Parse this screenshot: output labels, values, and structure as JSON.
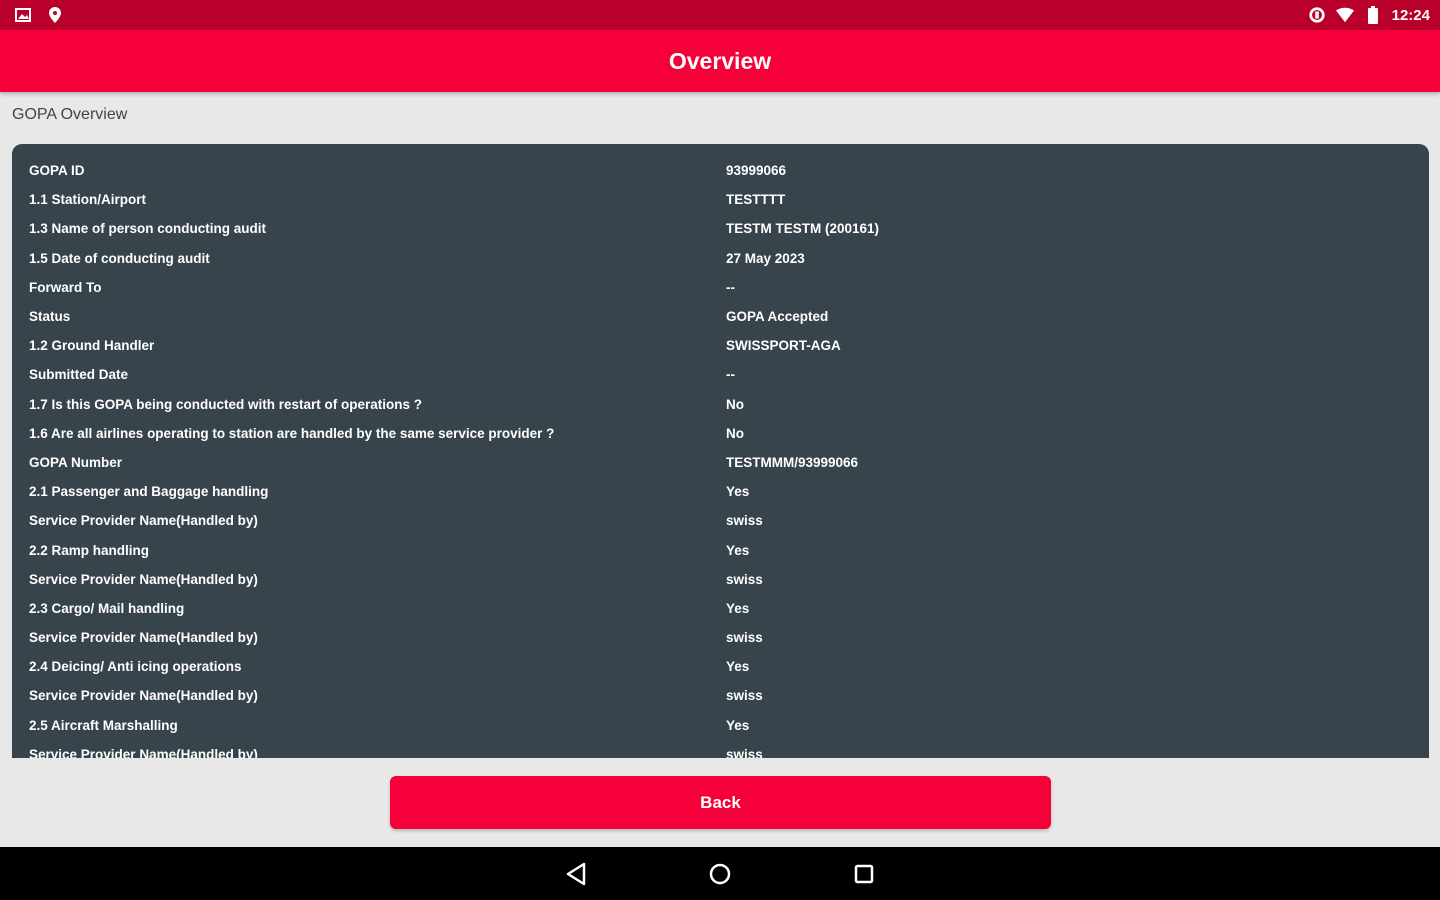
{
  "status_bar": {
    "time": "12:24",
    "left_icons": [
      "image-notification-icon",
      "location-pin-icon"
    ],
    "right_icons": [
      "data-saver-icon",
      "wifi-icon",
      "battery-icon"
    ]
  },
  "app_bar": {
    "title": "Overview"
  },
  "section": {
    "title": "GOPA Overview"
  },
  "details": [
    {
      "label": "GOPA ID",
      "value": "93999066"
    },
    {
      "label": "1.1 Station/Airport",
      "value": "TESTTTT"
    },
    {
      "label": "1.3 Name of person conducting audit",
      "value": "TESTM TESTM (200161)"
    },
    {
      "label": "1.5 Date of conducting audit",
      "value": "27 May 2023"
    },
    {
      "label": "Forward To",
      "value": "--"
    },
    {
      "label": "Status",
      "value": "GOPA Accepted"
    },
    {
      "label": "1.2 Ground Handler",
      "value": "SWISSPORT-AGA"
    },
    {
      "label": "Submitted Date",
      "value": "--"
    },
    {
      "label": "1.7 Is this GOPA being conducted with restart of operations ?",
      "value": "No"
    },
    {
      "label": "1.6 Are all airlines operating to station are handled by the same service provider ?",
      "value": "No"
    },
    {
      "label": "GOPA Number",
      "value": "TESTMMM/93999066"
    },
    {
      "label": "2.1 Passenger and Baggage handling",
      "value": "Yes"
    },
    {
      "label": "Service Provider Name(Handled by)",
      "value": "swiss"
    },
    {
      "label": "2.2 Ramp handling",
      "value": "Yes"
    },
    {
      "label": "Service Provider Name(Handled by)",
      "value": "swiss"
    },
    {
      "label": "2.3 Cargo/ Mail handling",
      "value": "Yes"
    },
    {
      "label": "Service Provider Name(Handled by)",
      "value": "swiss"
    },
    {
      "label": "2.4 Deicing/ Anti icing operations",
      "value": "Yes"
    },
    {
      "label": "Service Provider Name(Handled by)",
      "value": "swiss"
    },
    {
      "label": "2.5 Aircraft Marshalling",
      "value": "Yes"
    },
    {
      "label": "Service Provider Name(Handled by)",
      "value": "swiss"
    }
  ],
  "buttons": {
    "back": "Back"
  },
  "nav": {
    "icons": [
      "back-triangle-icon",
      "home-circle-icon",
      "recents-square-icon"
    ]
  },
  "colors": {
    "primary": "#f50038",
    "status_bar": "#b8002a",
    "card": "#37444b"
  }
}
